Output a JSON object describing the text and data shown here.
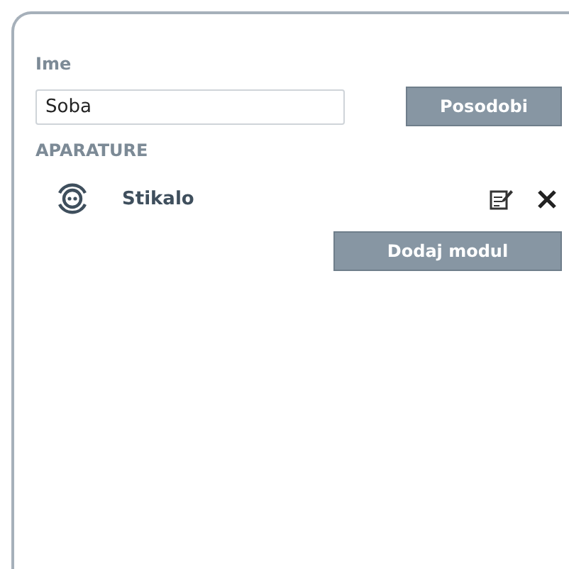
{
  "name_label": "Ime",
  "name_field": {
    "value": "Soba"
  },
  "update_button": "Posodobi",
  "devices_heading": "APARATURE",
  "devices": [
    {
      "name": "Stikalo"
    }
  ],
  "add_button": "Dodaj modul"
}
